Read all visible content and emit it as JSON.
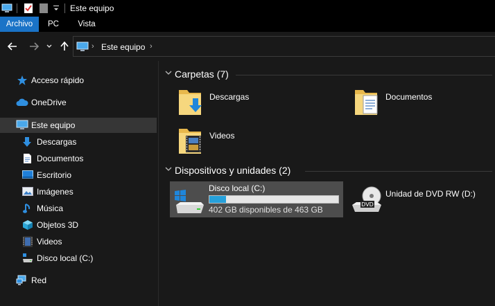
{
  "window": {
    "title": "Este equipo"
  },
  "ribbon": {
    "tabs": [
      {
        "label": "Archivo",
        "active": true
      },
      {
        "label": "PC",
        "active": false
      },
      {
        "label": "Vista",
        "active": false
      }
    ]
  },
  "address": {
    "path": "Este equipo"
  },
  "sidebar": {
    "items": [
      {
        "label": "Acceso rápido",
        "icon": "star-icon"
      },
      {
        "label": "OneDrive",
        "icon": "cloud-icon"
      },
      {
        "label": "Este equipo",
        "icon": "computer-icon",
        "selected": true
      },
      {
        "label": "Descargas",
        "icon": "download-icon"
      },
      {
        "label": "Documentos",
        "icon": "document-icon"
      },
      {
        "label": "Escritorio",
        "icon": "desktop-icon"
      },
      {
        "label": "Imágenes",
        "icon": "image-icon"
      },
      {
        "label": "Música",
        "icon": "music-icon"
      },
      {
        "label": "Objetos 3D",
        "icon": "cube-icon"
      },
      {
        "label": "Videos",
        "icon": "video-icon"
      },
      {
        "label": "Disco local (C:)",
        "icon": "drive-icon"
      },
      {
        "label": "Red",
        "icon": "network-icon"
      }
    ]
  },
  "content": {
    "folders_header": "Carpetas (7)",
    "folders": [
      {
        "label": "Descargas",
        "icon": "download-folder-icon"
      },
      {
        "label": "Documentos",
        "icon": "documents-folder-icon"
      },
      {
        "label": "Videos",
        "icon": "videos-folder-icon"
      }
    ],
    "devices_header": "Dispositivos y unidades (2)",
    "drives": [
      {
        "label": "Disco local (C:)",
        "free_text": "402 GB disponibles de 463 GB",
        "used_fraction": 0.13,
        "icon": "windows-drive-icon"
      },
      {
        "label": "Unidad de DVD RW (D:)",
        "icon": "dvd-drive-icon"
      }
    ]
  },
  "colors": {
    "accent": "#1a73c7",
    "progress": "#26a0da",
    "background": "#191919",
    "selected": "#363636"
  }
}
